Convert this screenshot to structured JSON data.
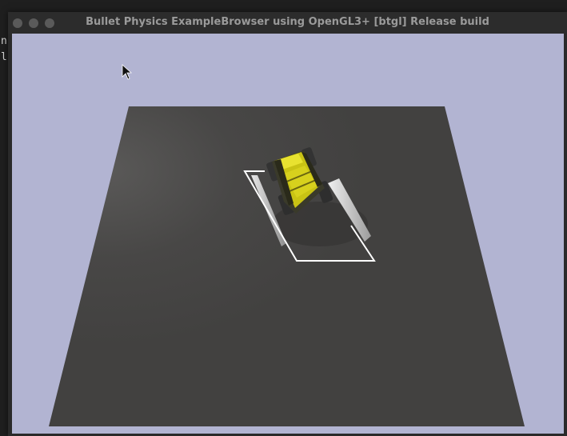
{
  "window": {
    "title": "Bullet Physics ExampleBrowser using OpenGL3+ [btgl] Release build"
  },
  "terminal": {
    "lines": [
      "n",
      "l"
    ]
  },
  "scene": {
    "background_color": "#b2b4d2",
    "ground_color": "#444342",
    "vehicle_color": "#d6d01a",
    "rail_color": "#c8c8c8"
  }
}
